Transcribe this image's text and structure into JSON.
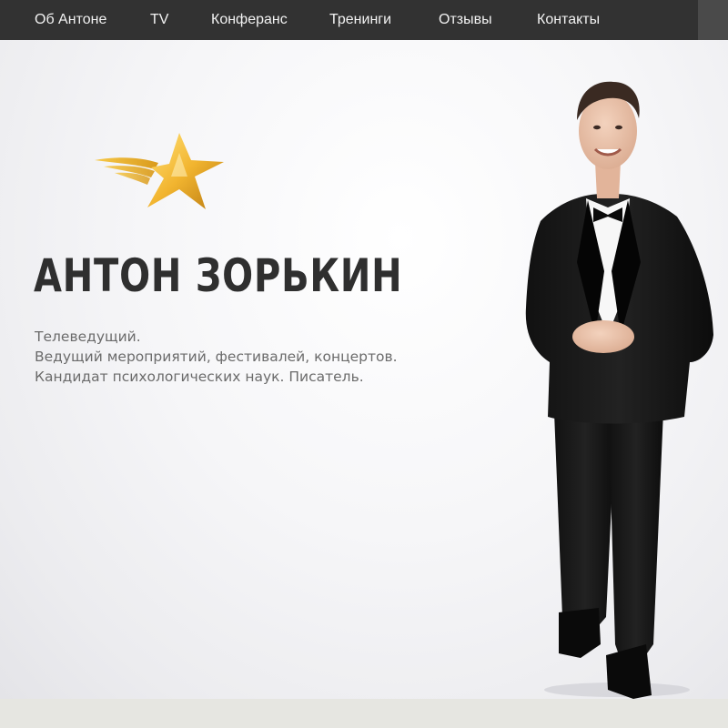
{
  "nav": {
    "items": [
      {
        "label": "Об Антоне"
      },
      {
        "label": "TV"
      },
      {
        "label": "Конферанс"
      },
      {
        "label": "Тренинги"
      },
      {
        "label": "Отзывы"
      },
      {
        "label": "Контакты"
      }
    ]
  },
  "hero": {
    "title": "АНТОН ЗОРЬКИН",
    "description": [
      "Телеведущий.",
      "Ведущий мероприятий, фестивалей, концертов.",
      "Кандидат психологических наук. Писатель."
    ],
    "logo_icon": "winged-star-logo",
    "photo_icon": "person-in-tuxedo-photo"
  },
  "colors": {
    "navbar": "#323232",
    "nav_text": "#f2f2f2",
    "title": "#2f2f2f",
    "description": "#6b6b6b",
    "logo_gold": "#f2b530"
  }
}
